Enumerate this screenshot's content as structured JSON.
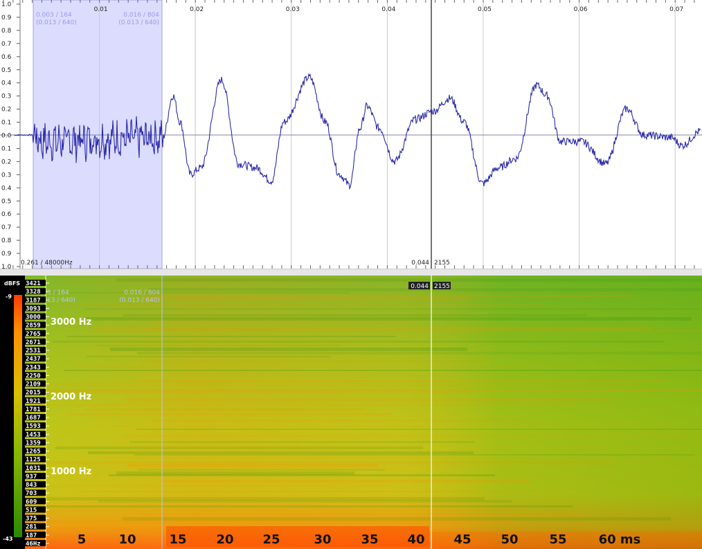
{
  "waveform": {
    "y_labels": [
      "1.0",
      "0.9",
      "0.8",
      "0.7",
      "0.6",
      "0.5",
      "0.4",
      "0.3",
      "0.2",
      "0.1",
      "0.0",
      "0.1",
      "0.2",
      "0.3",
      "0.4",
      "0.5",
      "0.6",
      "0.7",
      "0.8",
      "0.9",
      "1.0"
    ],
    "time_labels": [
      "0.01",
      "0.02",
      "0.03",
      "0.04",
      "0.05",
      "0.06",
      "0.07"
    ],
    "selection": {
      "start_label_1": "0.003 / 164",
      "start_label_2": "(0.013 / 640)",
      "end_label_1": "0.016 / 804",
      "end_label_2": "(0.013 / 640)"
    },
    "info_left": "0.261 / 48000Hz",
    "cursor_time": "0.044",
    "cursor_sample": "2155",
    "colors": {
      "wave": "#2a2aa8",
      "selection": "#dcdcff",
      "grid": "#c8c8c8"
    }
  },
  "spectrogram": {
    "colorbar": {
      "unit": "dBFS",
      "max": "-9",
      "min": "-43"
    },
    "freq_labels": [
      "3421",
      "3328",
      "3187",
      "3093",
      "3000",
      "2859",
      "2765",
      "2671",
      "2531",
      "2437",
      "2343",
      "2250",
      "2109",
      "2015",
      "1921",
      "1781",
      "1687",
      "1593",
      "1453",
      "1359",
      "1265",
      "1125",
      "1031",
      "937",
      "843",
      "703",
      "609",
      "515",
      "375",
      "281",
      "187",
      "46Hz"
    ],
    "overlay_freq": [
      "3000 Hz",
      "2000 Hz",
      "1000 Hz"
    ],
    "ms_labels": [
      "5",
      "10",
      "15",
      "20",
      "25",
      "30",
      "35",
      "40",
      "45",
      "50",
      "55",
      "60 ms"
    ],
    "sel_label_1": "3 / 164",
    "sel_label_2": "13 / 640)",
    "sel_end_1": "0.016 / 804",
    "sel_end_2": "(0.013 / 640)",
    "cursor_time": "0.044",
    "cursor_sample": "2155"
  }
}
